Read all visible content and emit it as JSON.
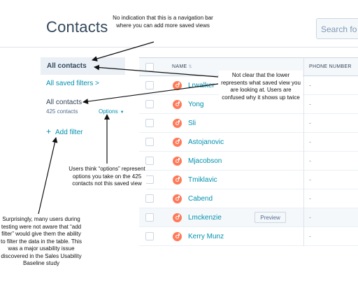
{
  "header": {
    "title": "Contacts",
    "search_placeholder": "Search fo"
  },
  "sidebar": {
    "active_view": "All contacts",
    "saved_filters_link": "All saved filters >",
    "current_view_name": "All contacts",
    "current_view_count": "425 contacts",
    "options_label": "Options",
    "add_filter_label": "Add filter"
  },
  "table": {
    "columns": [
      "NAME",
      "PHONE NUMBER"
    ],
    "rows": [
      {
        "name": "Lrwalker",
        "phone": "-"
      },
      {
        "name": "Yong",
        "phone": "-"
      },
      {
        "name": "Sli",
        "phone": "-"
      },
      {
        "name": "Astojanovic",
        "phone": "-"
      },
      {
        "name": "Mjacobson",
        "phone": "-"
      },
      {
        "name": "Tmiklavic",
        "phone": "-"
      },
      {
        "name": "Cabend",
        "phone": "-"
      },
      {
        "name": "Lmckenzie",
        "phone": "-",
        "preview": "Preview"
      },
      {
        "name": "Kerry Munz",
        "phone": "-"
      }
    ]
  },
  "annotations": {
    "nav_bar": "No indication that this is a navigation bar where you can add more saved views",
    "lower_view": "Not clear that the lower represents what saved view you are looking at. Users are confused why it shows up twice",
    "options": "Users think “options” represent options you take on the 425 contacts not this saved view",
    "add_filter": "Surprisingly, many users during testing were not aware that “add filter” would give them the ability to filter the data in the table. This was a major usability issue discovered in the Sales Usability Baseline study"
  },
  "colors": {
    "link": "#0091ae",
    "text": "#33475b",
    "hubspot_orange": "#ff7a59",
    "active_tab_bg": "#eaf0f6"
  },
  "icons": {
    "contact_avatar": "hubspot-sprocket-icon",
    "sort": "sort-arrows-icon",
    "add": "plus-icon",
    "dropdown": "caret-down-icon"
  }
}
